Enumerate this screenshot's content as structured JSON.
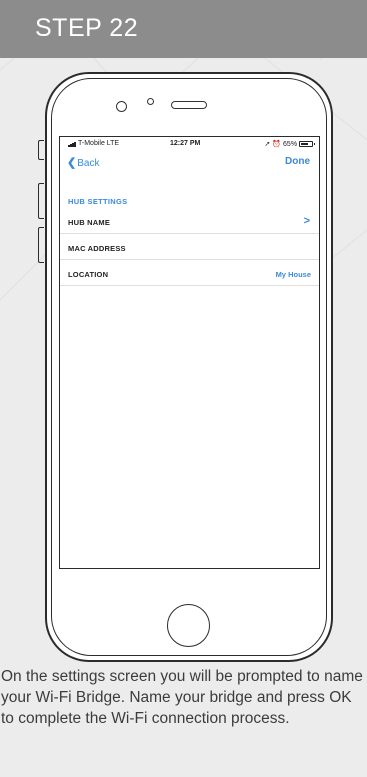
{
  "header": {
    "title": "STEP 22"
  },
  "status_bar": {
    "carrier": "T-Mobile  LTE",
    "time": "12:27 PM",
    "battery": "65%",
    "battery_level": 0.65
  },
  "nav": {
    "back_label": "Back",
    "done_label": "Done"
  },
  "settings": {
    "section_title": "HUB SETTINGS",
    "rows": [
      {
        "label": "HUB NAME",
        "value": "",
        "chevron": ">"
      },
      {
        "label": "MAC ADDRESS",
        "value": ""
      },
      {
        "label": "LOCATION",
        "value": "My House"
      }
    ]
  },
  "caption": "On the settings screen you will be prompted to name your Wi-Fi Bridge. Name your bridge and press OK to complete the Wi-Fi connection process.",
  "colors": {
    "header_bg": "#8c8c8c",
    "accent": "#3a8bd8",
    "page_bg": "#ececec"
  },
  "icons": [
    "signal-icon",
    "location-arrow-icon",
    "alarm-icon",
    "battery-icon",
    "back-chevron-icon",
    "row-chevron-icon"
  ]
}
